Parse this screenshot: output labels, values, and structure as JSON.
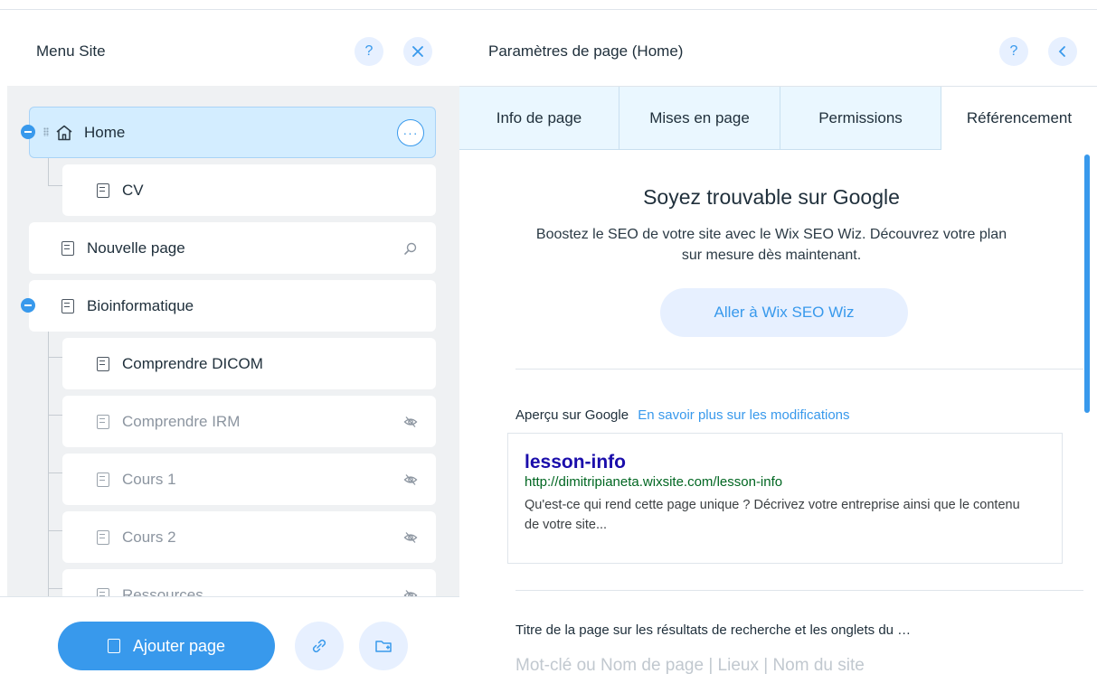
{
  "left": {
    "title": "Menu Site",
    "help_icon": "question-icon",
    "close_icon": "close-icon",
    "pages": [
      {
        "label": "Home",
        "icon": "home-icon",
        "selected": true
      },
      {
        "label": "CV",
        "icon": "page-icon"
      },
      {
        "label": "Nouvelle page",
        "icon": "page-icon",
        "status_icon": "search-seo-icon"
      },
      {
        "label": "Bioinformatique",
        "icon": "page-icon"
      },
      {
        "label": "Comprendre DICOM",
        "icon": "page-icon"
      },
      {
        "label": "Comprendre IRM",
        "icon": "page-icon",
        "status_icon": "hidden-eye-icon"
      },
      {
        "label": "Cours 1",
        "icon": "page-icon",
        "status_icon": "hidden-eye-icon"
      },
      {
        "label": "Cours 2",
        "icon": "page-icon",
        "status_icon": "hidden-eye-icon"
      },
      {
        "label": "Ressources",
        "icon": "page-icon",
        "status_icon": "hidden-eye-icon"
      }
    ],
    "add_page_label": "Ajouter page",
    "add_link_icon": "link-icon",
    "add_folder_icon": "folder-icon"
  },
  "right": {
    "title": "Paramètres de page (Home)",
    "tabs": [
      {
        "label": "Info de page"
      },
      {
        "label": "Mises en page"
      },
      {
        "label": "Permissions"
      },
      {
        "label": "Référencement",
        "active": true
      }
    ],
    "seo": {
      "title": "Soyez trouvable sur Google",
      "description": "Boostez le SEO de votre site avec le Wix SEO Wiz. Découvrez votre plan sur mesure dès maintenant.",
      "button": "Aller à Wix SEO Wiz"
    },
    "preview": {
      "label": "Aperçu sur Google",
      "link": "En savoir plus sur les modifications",
      "title": "lesson-info",
      "url": "http://dimitripianeta.wixsite.com/lesson-info",
      "description": "Qu'est-ce qui rend cette page unique ? Décrivez votre entreprise ainsi que le contenu de votre site..."
    },
    "field": {
      "label": "Titre de la page sur les résultats de recherche et les onglets du …",
      "placeholder": "Mot-clé ou Nom de page | Lieux | Nom du site"
    }
  },
  "colors": {
    "accent": "#3899ec",
    "selected_bg": "#d3edff",
    "tree_bg": "#eff1f3",
    "google_title": "#1a0dab",
    "google_url": "#006621"
  }
}
